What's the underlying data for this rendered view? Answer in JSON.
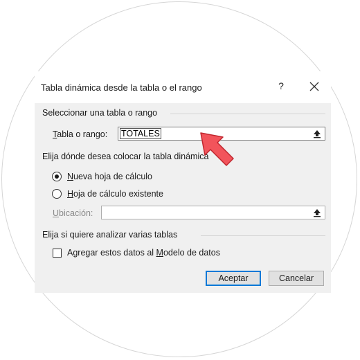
{
  "dialog": {
    "title": "Tabla dinámica desde la tabla o el rango",
    "help_label": "?",
    "close_icon": "close-icon"
  },
  "section_select": {
    "heading": "Seleccionar una tabla o rango",
    "range_label_u": "T",
    "range_label_rest": "abla o rango:",
    "range_value": "TOTALES"
  },
  "section_place": {
    "heading": "Elija dónde desea colocar la tabla dinámica",
    "option_new_u": "N",
    "option_new_rest": "ueva hoja de cálculo",
    "option_new_checked": true,
    "option_existing_u": "H",
    "option_existing_rest": "oja de cálculo existente",
    "option_existing_checked": false,
    "location_label_u": "U",
    "location_label_rest": "bicación:",
    "location_value": ""
  },
  "section_multi": {
    "heading": "Elija si quiere analizar varias tablas",
    "checkbox_pre": "Agregar estos datos al ",
    "checkbox_u": "M",
    "checkbox_post": "odelo de datos",
    "checkbox_checked": false
  },
  "buttons": {
    "ok": "Aceptar",
    "cancel": "Cancelar"
  },
  "colors": {
    "arrow_fill": "#f2545b",
    "arrow_stroke": "#c0262e",
    "default_button_border": "#0078d7"
  }
}
